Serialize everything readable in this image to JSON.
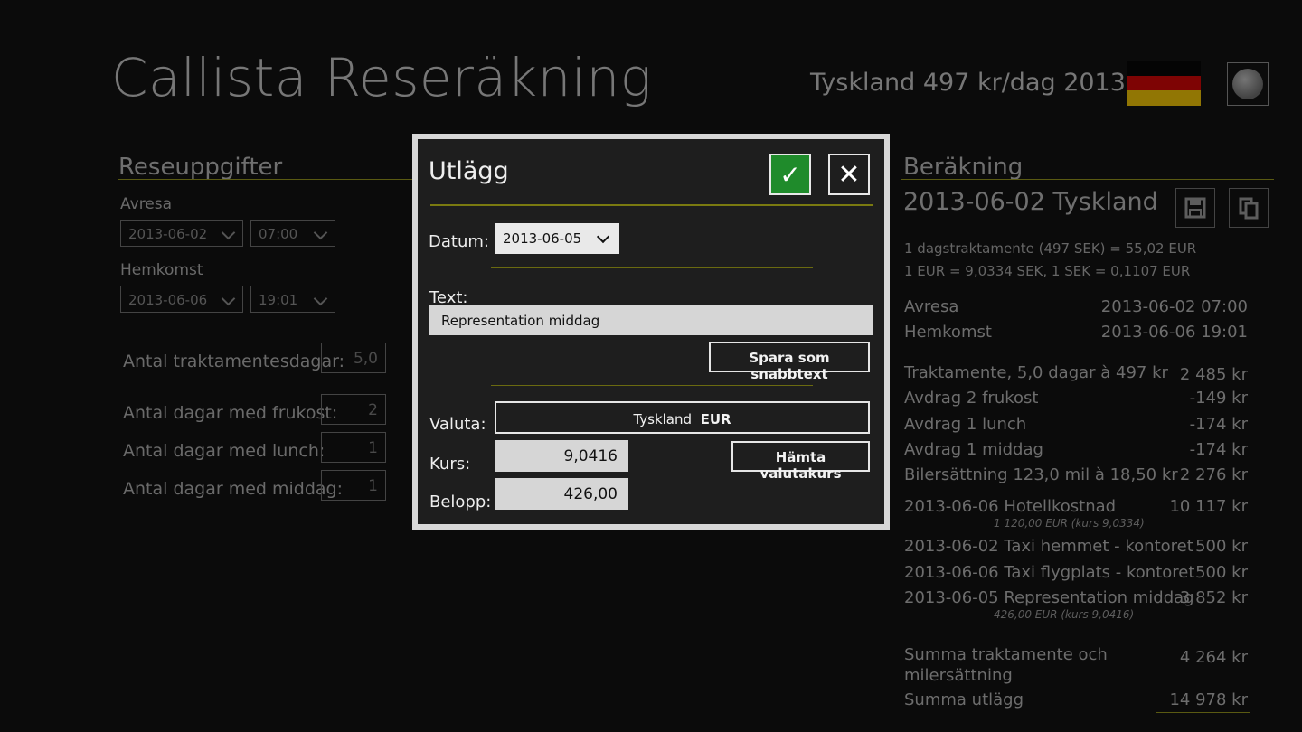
{
  "app": {
    "title": "Callista Reseräkning",
    "country_info": "Tyskland 497 kr/dag 2013"
  },
  "flag": {
    "colors": [
      "#000000",
      "#dd0000",
      "#ffce00"
    ]
  },
  "trip": {
    "title": "Reseuppgifter",
    "departure_label": "Avresa",
    "departure_date": "2013-06-02",
    "departure_time": "07:00",
    "return_label": "Hemkomst",
    "return_date": "2013-06-06",
    "return_time": "19:01",
    "allowance_days_label": "Antal traktamentesdagar:",
    "allowance_days": "5,0",
    "breakfast_label": "Antal dagar med frukost:",
    "breakfast": "2",
    "lunch_label": "Antal dagar med lunch:",
    "lunch": "1",
    "dinner_label": "Antal dagar med middag:",
    "dinner": "1"
  },
  "calc": {
    "title": "Beräkning",
    "subtitle": "2013-06-02 Tyskland",
    "info1": "1 dagstraktamente (497 SEK) = 55,02 EUR",
    "info2": "1 EUR = 9,0334 SEK, 1 SEK = 0,1107 EUR",
    "departure_label": "Avresa",
    "departure": "2013-06-02 07:00",
    "return_label": "Hemkomst",
    "return": "2013-06-06 19:01",
    "rows": [
      {
        "label": "Traktamente, 5,0 dagar à 497 kr",
        "value": "2 485 kr"
      },
      {
        "label": "Avdrag 2 frukost",
        "value": "-149 kr"
      },
      {
        "label": "Avdrag 1 lunch",
        "value": "-174 kr"
      },
      {
        "label": "Avdrag 1 middag",
        "value": "-174 kr"
      },
      {
        "label": "Bilersättning 123,0 mil à 18,50 kr",
        "value": "2 276 kr"
      }
    ],
    "expenses": [
      {
        "label": "2013-06-06 Hotellkostnad",
        "value": "10 117 kr",
        "note": "1 120,00 EUR (kurs 9,0334)"
      },
      {
        "label": "2013-06-02 Taxi hemmet - kontoret",
        "value": "500 kr",
        "note": ""
      },
      {
        "label": "2013-06-06 Taxi flygplats - kontoret",
        "value": "500 kr",
        "note": ""
      },
      {
        "label": "2013-06-05 Representation middag",
        "value": "3 852 kr",
        "note": "426,00 EUR (kurs 9,0416)"
      }
    ],
    "sum_allowance_label_1": "Summa traktamente och",
    "sum_allowance_label_2": "milersättning",
    "sum_allowance": "4 264 kr",
    "sum_expenses_label": "Summa utlägg",
    "sum_expenses": "14 978 kr"
  },
  "dialog": {
    "title": "Utlägg",
    "date_label": "Datum:",
    "date": "2013-06-05",
    "text_label": "Text:",
    "text_value": "Representation middag",
    "save_snippet": "Spara som snabbtext",
    "currency_label": "Valuta:",
    "currency_country": "Tyskland",
    "currency_code": "EUR",
    "rate_label": "Kurs:",
    "rate": "9,0416",
    "fetch_rate": "Hämta valutakurs",
    "amount_label": "Belopp:",
    "amount": "426,00"
  },
  "icons": {
    "ok": "checkmark-icon",
    "close": "close-icon",
    "save": "save-icon",
    "copy": "copy-icon",
    "wiki": "wikipedia-icon"
  }
}
